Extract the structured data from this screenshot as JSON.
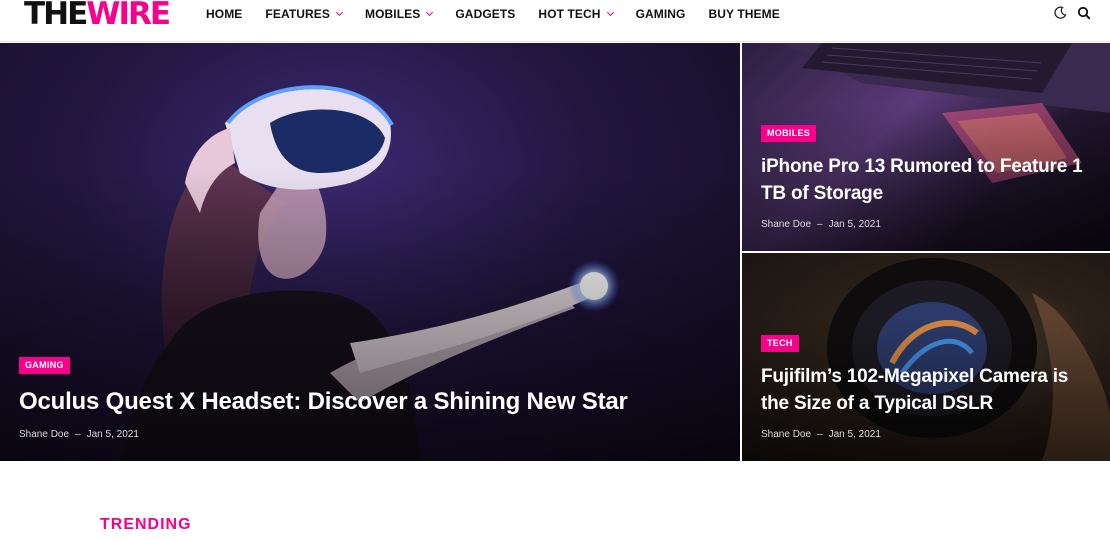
{
  "header": {
    "logo_the": "THE",
    "logo_wire": "WIRE",
    "nav": [
      {
        "label": "HOME",
        "dropdown": false
      },
      {
        "label": "FEATURES",
        "dropdown": true
      },
      {
        "label": "MOBILES",
        "dropdown": true
      },
      {
        "label": "GADGETS",
        "dropdown": false
      },
      {
        "label": "HOT TECH",
        "dropdown": true
      },
      {
        "label": "GAMING",
        "dropdown": false
      },
      {
        "label": "BUY THEME",
        "dropdown": false
      }
    ],
    "icons": [
      "moon-icon",
      "search-icon"
    ]
  },
  "colors": {
    "accent": "#f6008c",
    "text": "#111111"
  },
  "posts": {
    "hero": {
      "category": "GAMING",
      "title": "Oculus Quest X Headset: Discover a Shining New Star",
      "author": "Shane Doe",
      "date": "Jan 5, 2021"
    },
    "side1": {
      "category": "MOBILES",
      "title": "iPhone Pro 13 Rumored to Feature 1 TB of Storage",
      "author": "Shane Doe",
      "date": "Jan 5, 2021"
    },
    "side2": {
      "category": "TECH",
      "title": "Fujifilm’s 102-Megapixel Camera is the Size of a Typical DSLR",
      "author": "Shane Doe",
      "date": "Jan 5, 2021"
    }
  },
  "sections": {
    "trending": "TRENDING"
  }
}
